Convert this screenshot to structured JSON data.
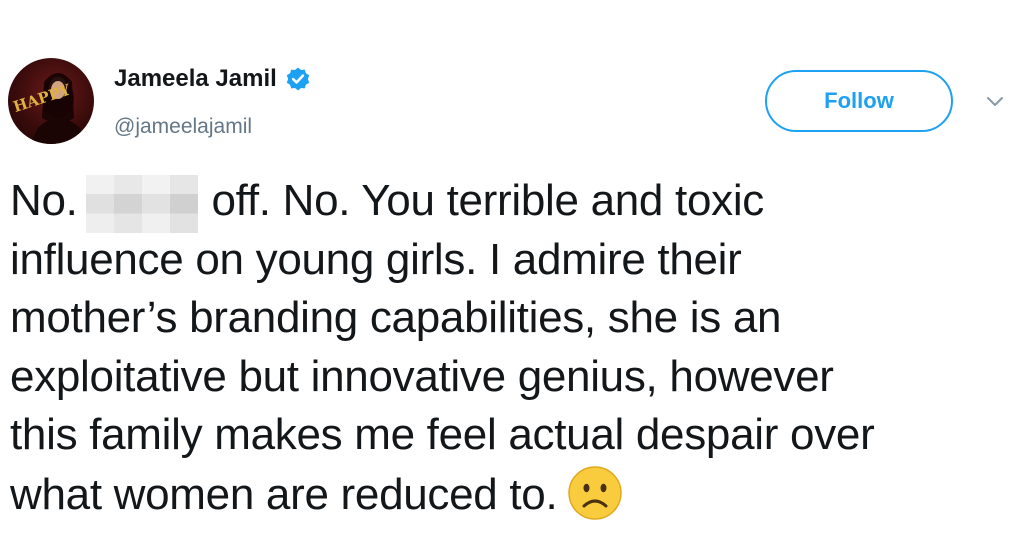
{
  "author": {
    "display_name": "Jameela Jamil",
    "handle": "@jameelajamil",
    "avatar_icon": "avatar-photo",
    "avatar_text": "HAPPY",
    "verified_icon": "verified-badge-icon",
    "verified_color": "#1da1f2"
  },
  "actions": {
    "follow_label": "Follow",
    "follow_color": "#1da1f2",
    "more_icon": "chevron-down-icon"
  },
  "tweet": {
    "lines": [
      {
        "before_redaction": "No.",
        "after_redaction": "off. No. You terrible and toxic"
      },
      {
        "text": "influence on young girls. I admire their"
      },
      {
        "text": "mother’s branding capabilities, she is an"
      },
      {
        "text": "exploitative but innovative genius, however"
      },
      {
        "text": "this family makes me feel actual despair over"
      },
      {
        "text": "what women are reduced to."
      }
    ],
    "redaction": "pixelated-censor-block",
    "trailing_emoji": "frowning-face-emoji",
    "text_color": "#14171a"
  }
}
